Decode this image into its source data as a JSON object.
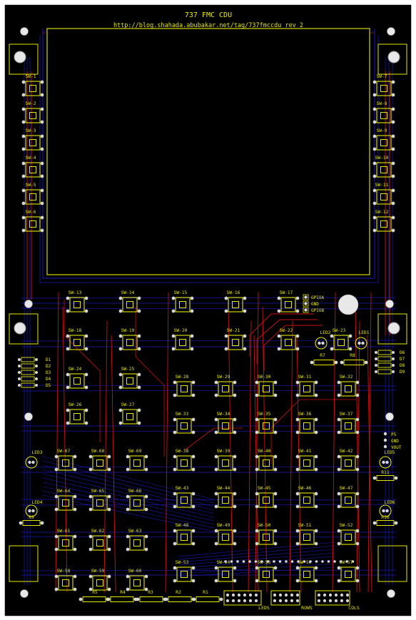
{
  "board": {
    "title": "737 FMC CDU",
    "subtitle": "http://blog.shahada.abubakar.net/tag/737fmccdu rev 2",
    "colors": {
      "copper_front": "#cc1111",
      "copper_back": "#1a1ab8",
      "silk": "#e6e600",
      "background": "#000000",
      "outline": "#ffffff"
    }
  },
  "switches": {
    "left_column": [
      "SW-1",
      "SW-2",
      "SW-3",
      "SW-4",
      "SW-5",
      "SW-6"
    ],
    "right_column": [
      "SW-7",
      "SW-8",
      "SW-9",
      "SW-10",
      "SW-11",
      "SW-12"
    ],
    "row_13": [
      "SW-13",
      "SW-14",
      "SW-15",
      "SW-16",
      "SW-17"
    ],
    "row_18": [
      "SW-18",
      "SW-19",
      "SW-20",
      "SW-21",
      "SW-22",
      "SW-23"
    ],
    "left_block_a": [
      "SW-24",
      "SW-25"
    ],
    "left_block_b": [
      "SW-26",
      "SW-27"
    ],
    "grid_row_1": [
      "SW-28",
      "SW-29",
      "SW-30",
      "SW-31",
      "SW-32"
    ],
    "grid_row_2": [
      "SW-33",
      "SW-34",
      "SW-35",
      "SW-36",
      "SW-37"
    ],
    "grid_row_3": [
      "SW-38",
      "SW-39",
      "SW-40",
      "SW-41",
      "SW-42"
    ],
    "grid_row_4": [
      "SW-43",
      "SW-44",
      "SW-45",
      "SW-46",
      "SW-47"
    ],
    "grid_row_5": [
      "SW-48",
      "SW-49",
      "SW-50",
      "SW-51",
      "SW-52"
    ],
    "grid_row_6": [
      "SW-53",
      "SW-54",
      "SW-55",
      "SW-56",
      "SW-57"
    ],
    "lower_left_1": [
      "SW-67",
      "SW-68",
      "SW-69"
    ],
    "lower_left_2": [
      "SW-64",
      "SW-65",
      "SW-66"
    ],
    "lower_left_3": [
      "SW-61",
      "SW-62",
      "SW-63"
    ],
    "lower_left_4": [
      "SW-58",
      "SW-59",
      "SW-60"
    ]
  },
  "leds": [
    "LED1",
    "LED2",
    "LED3",
    "LED4",
    "LED5",
    "LED6"
  ],
  "resistors_bottom": [
    "R5",
    "R4",
    "R3",
    "R2",
    "R1"
  ],
  "resistors_side": [
    "R7",
    "R8",
    "R9",
    "R10",
    "R11"
  ],
  "diodes_left": [
    "D1",
    "D2",
    "D3",
    "D4",
    "D5"
  ],
  "diodes_right": [
    "D6",
    "D7",
    "D8",
    "D9"
  ],
  "gpio_labels": [
    "GPIOA",
    "GND",
    "GPIOB"
  ],
  "power_labels": [
    "P5",
    "GND",
    "VOUT"
  ],
  "connectors": [
    "LEDS",
    "ROWS",
    "COLS"
  ]
}
